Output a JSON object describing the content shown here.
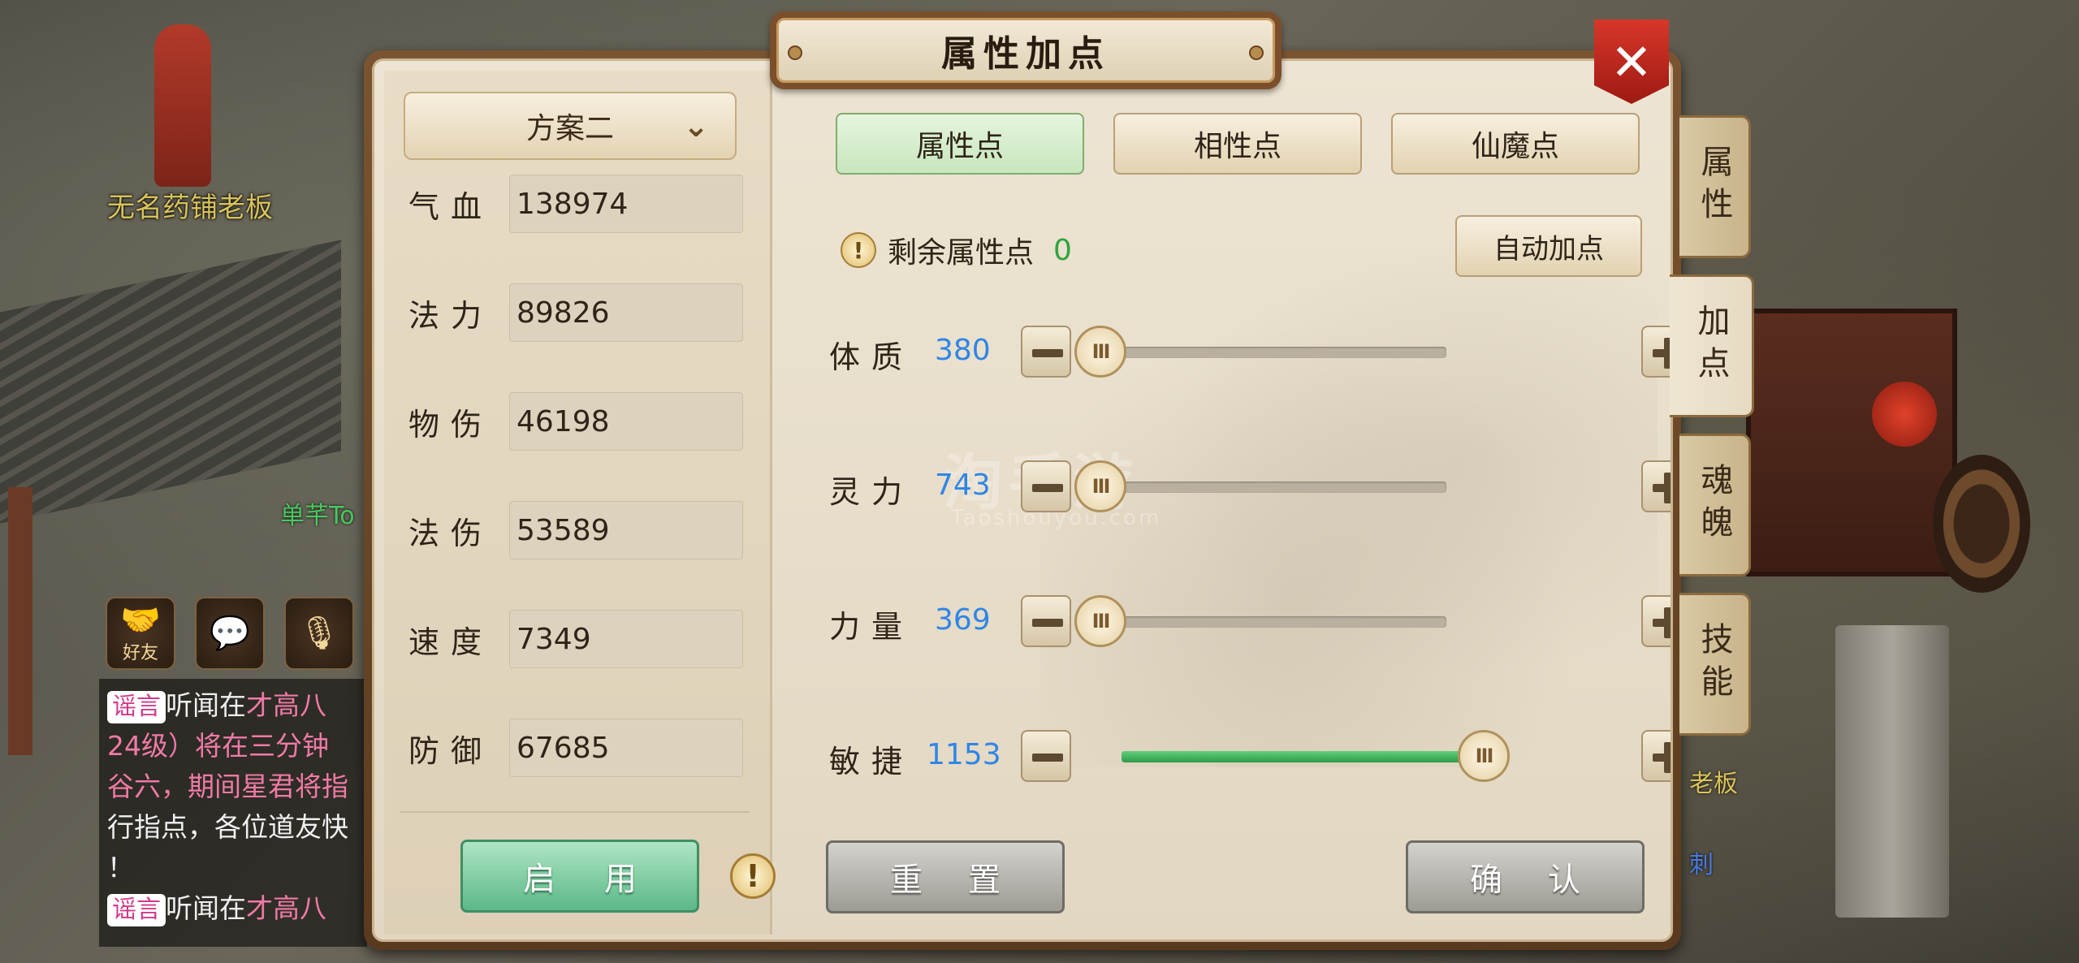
{
  "scene": {
    "npc_label": "无名药铺老板",
    "npc2_label": "单芊To",
    "right_label": "老板",
    "right_label2": "刺"
  },
  "chat": {
    "icons": [
      {
        "name": "friends",
        "label": "好友",
        "glyph": "🤝"
      },
      {
        "name": "message",
        "label": "",
        "glyph": "💬"
      },
      {
        "name": "voice",
        "label": "",
        "glyph": "🎙"
      }
    ],
    "lines": [
      {
        "tag": "谣言",
        "text": "听闻在",
        "highlight": "才高八"
      },
      {
        "text": "24级）将在",
        "highlight": "三分钟"
      },
      {
        "text": "谷六，期间星君将指"
      },
      {
        "text": "行指点，各位道友快"
      },
      {
        "text": "！"
      },
      {
        "tag": "谣言",
        "text": "听闻在",
        "highlight": "才高八"
      }
    ]
  },
  "dialog": {
    "title": "属性加点",
    "close_label": "✕",
    "plan": {
      "selected": "方案二",
      "chevron": "⌄"
    },
    "stats": [
      {
        "label": "气血",
        "value": "138974"
      },
      {
        "label": "法力",
        "value": "89826"
      },
      {
        "label": "物伤",
        "value": "46198"
      },
      {
        "label": "法伤",
        "value": "53589"
      },
      {
        "label": "速度",
        "value": "7349"
      },
      {
        "label": "防御",
        "value": "67685"
      }
    ],
    "enable_button": [
      "启",
      "用"
    ],
    "info_glyph": "!",
    "tabs": [
      {
        "label": "属性点",
        "active": true
      },
      {
        "label": "相性点",
        "active": false
      },
      {
        "label": "仙魔点",
        "active": false
      }
    ],
    "remaining": {
      "label": "剩余属性点",
      "value": "0"
    },
    "auto_button": "自动加点",
    "attributes": [
      {
        "label": "体质",
        "value": "380",
        "fill": 0.0
      },
      {
        "label": "灵力",
        "value": "743",
        "fill": 0.0
      },
      {
        "label": "力量",
        "value": "369",
        "fill": 0.0
      },
      {
        "label": "敏捷",
        "value": "1153",
        "fill": 1.0
      }
    ],
    "thumb_glyph": "III",
    "reset_button": [
      "重",
      "置"
    ],
    "confirm_button": [
      "确",
      "认"
    ],
    "watermark": "淘手游",
    "watermark_sub": "Taoshouyou.com"
  },
  "side_tabs": [
    {
      "label": "属性",
      "active": false
    },
    {
      "label": "加点",
      "active": true
    },
    {
      "label": "魂魄",
      "active": false
    },
    {
      "label": "技能",
      "active": false
    }
  ]
}
